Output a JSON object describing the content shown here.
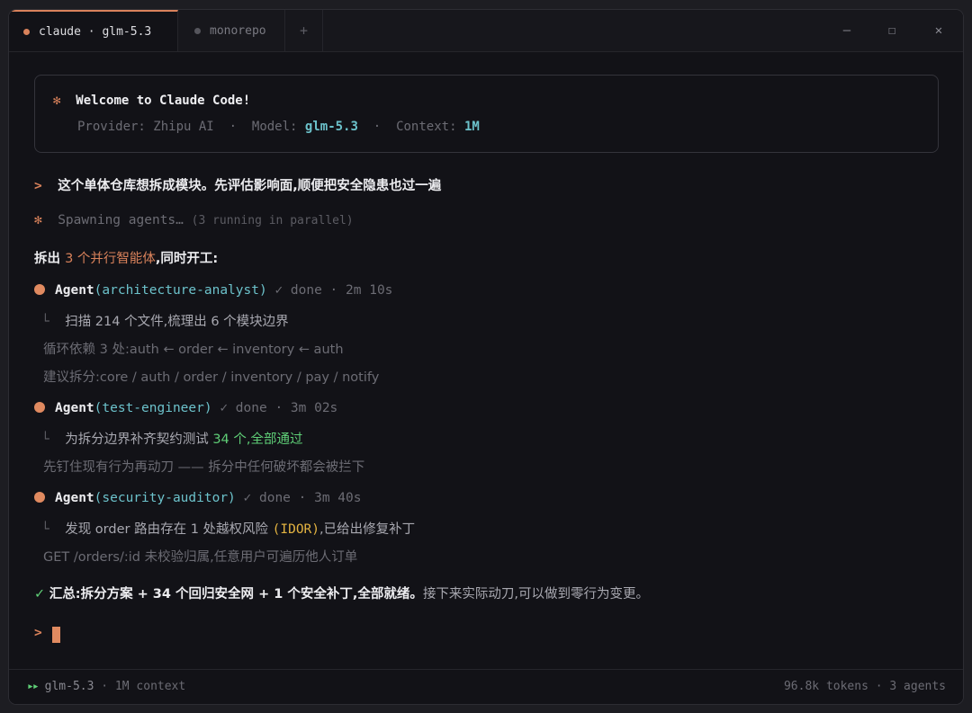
{
  "tabs": [
    {
      "label": "claude · glm-5.3",
      "active": true
    },
    {
      "label": "monorepo",
      "active": false
    }
  ],
  "tab_add": "+",
  "window_controls": {
    "minimize": "—",
    "maximize": "☐",
    "close": "✕"
  },
  "welcome": {
    "icon": "✻",
    "title": "Welcome to Claude Code!",
    "provider_label": "Provider: ",
    "provider": "Zhipu AI",
    "sep": "  ·  ",
    "model_label": "Model: ",
    "model": "glm-5.3",
    "context_label": "Context: ",
    "context": "1M"
  },
  "prompt_symbol": ">",
  "user_prompt": "这个单体仓库想拆成模块。先评估影响面,顺便把安全隐患也过一遍",
  "spawning": {
    "icon": "✻",
    "text": "Spawning agents…",
    "note": "(3 running in parallel)"
  },
  "split_line": {
    "prefix": "拆出 ",
    "highlight": "3 个并行智能体",
    "suffix": ",同时开工:"
  },
  "agents": [
    {
      "label": "Agent",
      "name": "(architecture-analyst)",
      "status": "✓ done · 2m 10s",
      "result_a": "扫描 214 个文件,梳理出 6 个模块边界",
      "detail1": "循环依赖 3 处:auth ← order ← inventory ← auth",
      "detail2": "建议拆分:core / auth / order / inventory / pay / notify"
    },
    {
      "label": "Agent",
      "name": "(test-engineer)",
      "status": "✓ done · 3m 02s",
      "result_a": "为拆分边界补齐契约测试 ",
      "result_b": "34 个,全部通过",
      "detail1": "先钉住现有行为再动刀 —— 拆分中任何破坏都会被拦下"
    },
    {
      "label": "Agent",
      "name": "(security-auditor)",
      "status": "✓ done · 3m 40s",
      "result_a": "发现 order 路由存在 1 处越权风险 ",
      "result_b": "(IDOR)",
      "result_c": ",已给出修复补丁",
      "detail1": "GET /orders/:id 未校验归属,任意用户可遍历他人订单"
    }
  ],
  "summary": {
    "check": "✓",
    "bold": "汇总:拆分方案 + 34 个回归安全网 + 1 个安全补丁,全部就绪。",
    "rest": "接下来实际动刀,可以做到零行为变更。"
  },
  "statusbar": {
    "arrows": "▸▸",
    "model": "glm-5.3",
    "context": " · 1M context",
    "tokens": "96.8k tokens",
    "agents": " · 3 agents"
  },
  "colors": {
    "accent": "#d9825b",
    "teal": "#6cc2cb",
    "green": "#5fcf77",
    "yellow": "#e3b341"
  }
}
